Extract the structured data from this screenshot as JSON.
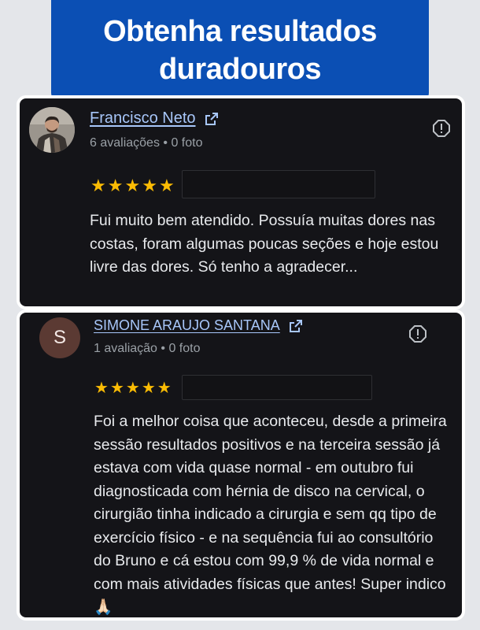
{
  "banner": {
    "title": "Obtenha resultados duradouros"
  },
  "reviews": [
    {
      "name": "Francisco Neto",
      "meta": "6 avaliações • 0 foto",
      "avatar": "photo",
      "rating": 5,
      "text": "Fui muito bem atendido. Possuía muitas dores nas costas, foram algumas poucas seções e hoje estou livre das dores. Só tenho a agradecer..."
    },
    {
      "name": "SIMONE ARAUJO SANTANA",
      "meta": "1 avaliação • 0 foto",
      "avatar_letter": "S",
      "rating": 5,
      "text": "Foi a melhor coisa que aconteceu, desde a primeira sessão resultados positivos e na terceira sessão já estava com vida quase normal - em outubro fui diagnosticada com hérnia de disco na cervical, o cirurgião tinha indicado a cirurgia e sem qq tipo de exercício físico - e na sequência fui ao consultório do Bruno e cá estou com 99,9 % de vida normal e com mais atividades físicas que antes! Super indico 🙏🏻"
    }
  ],
  "icons": {
    "external_link": "external-link-icon",
    "report": "report-icon",
    "star": "star-icon"
  },
  "colors": {
    "banner": "#0b4fb4",
    "card": "#141418",
    "link": "#a8c7fa",
    "star": "#fbbc04"
  }
}
